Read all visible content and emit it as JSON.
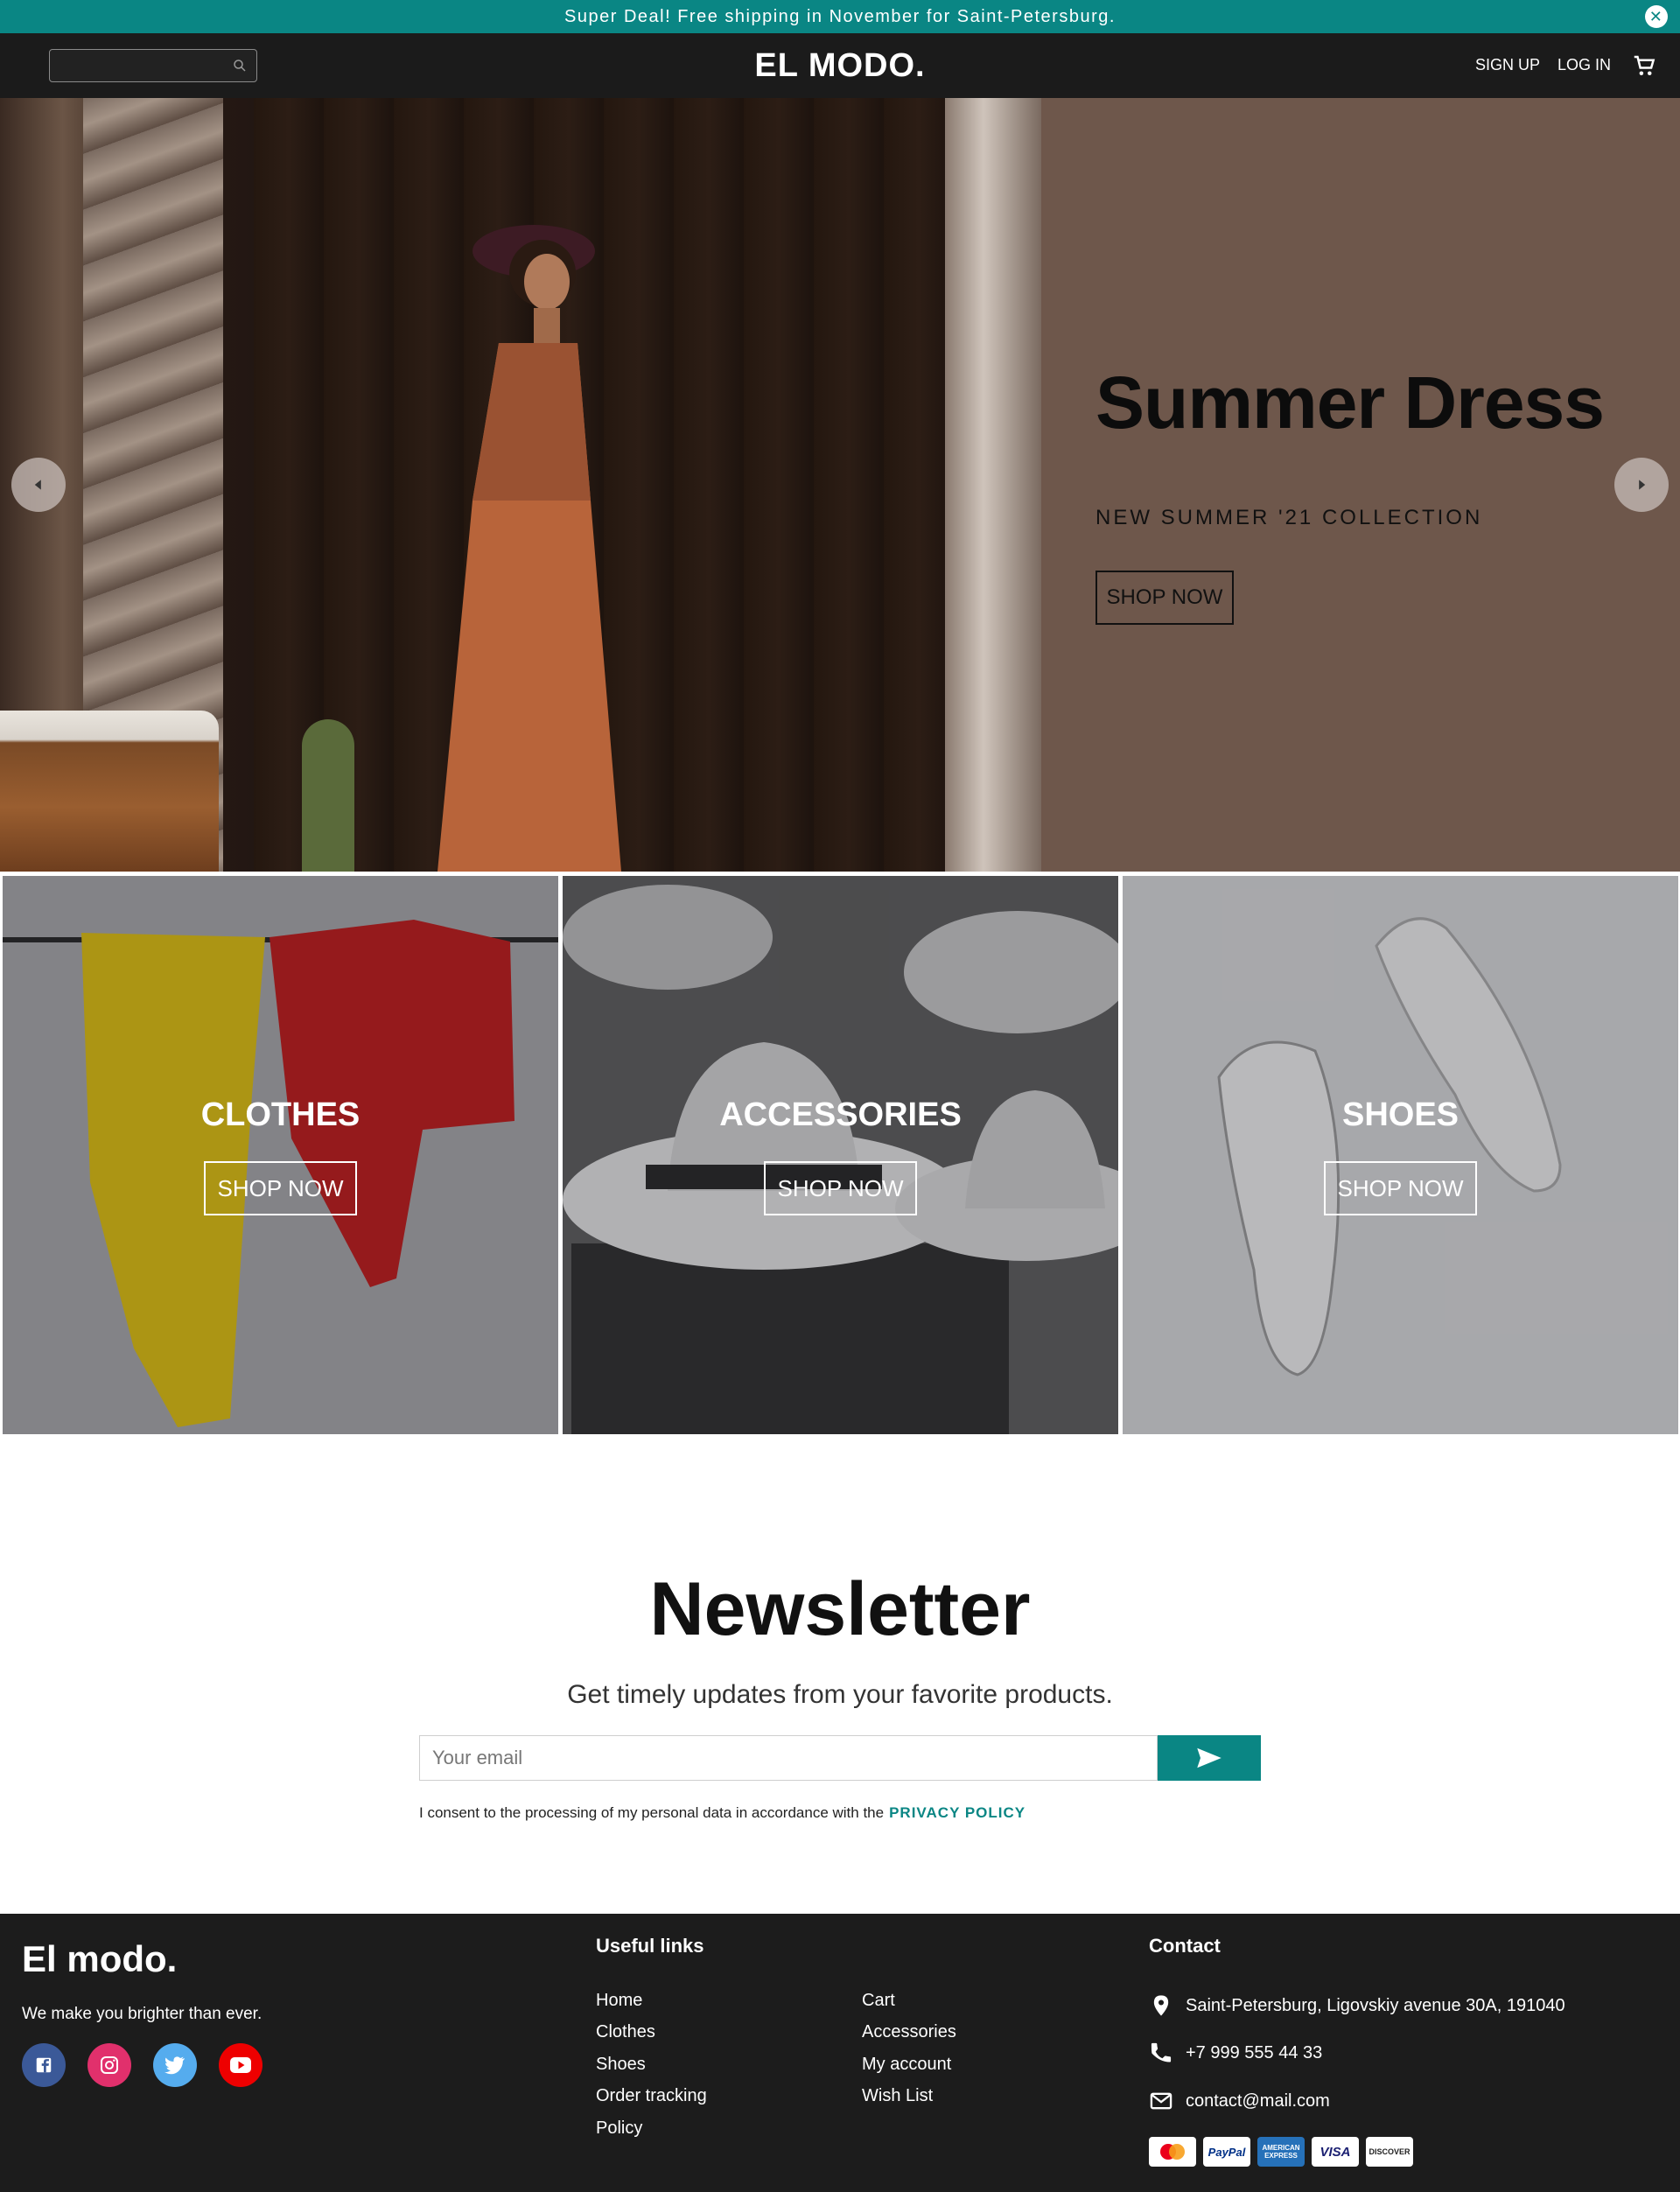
{
  "promo": {
    "text": "Super Deal! Free shipping in November for Saint-Petersburg."
  },
  "header": {
    "logo": "EL MODO.",
    "search_placeholder": "",
    "signup": "SIGN UP",
    "login": "LOG IN"
  },
  "hero": {
    "title": "Summer Dress",
    "subtitle": "NEW SUMMER '21 COLLECTION",
    "button": "SHOP NOW"
  },
  "categories": [
    {
      "title": "CLOTHES",
      "button": "SHOP NOW"
    },
    {
      "title": "ACCESSORIES",
      "button": "SHOP NOW"
    },
    {
      "title": "SHOES",
      "button": "SHOP NOW"
    }
  ],
  "newsletter": {
    "title": "Newsletter",
    "subtitle": "Get timely updates from your favorite products.",
    "placeholder": "Your email",
    "consent": "I consent to the processing of my personal data in accordance with the",
    "policy": "PRIVACY POLICY"
  },
  "footer": {
    "logo": "El modo.",
    "tagline": "We make you brighter than ever.",
    "useful_title": "Useful links",
    "links_col1": [
      "Home",
      "Clothes",
      "Shoes",
      "Order tracking",
      "Policy"
    ],
    "links_col2": [
      "Cart",
      "Accessories",
      "My account",
      "Wish List"
    ],
    "contact_title": "Contact",
    "address": "Saint-Petersburg, Ligovskiy avenue 30A, 191040",
    "phone": "+7 999 555 44 33",
    "email": "contact@mail.com",
    "payments": [
      "MasterCard",
      "PayPal",
      "AMERICAN EXPRESS",
      "VISA",
      "DISCOVER"
    ]
  },
  "colors": {
    "accent": "#0a8684",
    "header_bg": "#1b1b1b",
    "hero_bg": "#6e574b",
    "footer_bg": "#1c1c1c"
  },
  "icons": [
    "search-icon",
    "close-icon",
    "cart-icon",
    "chevron-left-icon",
    "chevron-right-icon",
    "send-icon",
    "facebook-icon",
    "instagram-icon",
    "twitter-icon",
    "youtube-icon",
    "location-icon",
    "phone-icon",
    "mail-icon"
  ]
}
